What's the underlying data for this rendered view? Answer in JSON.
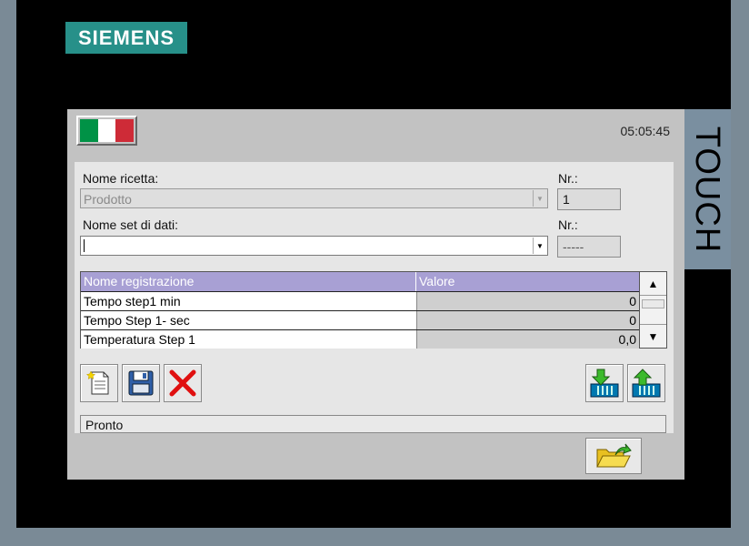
{
  "brand": {
    "logo_text": "SIEMENS",
    "side_label": "TOUCH"
  },
  "header": {
    "flag_colors": [
      "#009246",
      "#ffffff",
      "#ce2b37"
    ],
    "clock": "05:05:45"
  },
  "recipe": {
    "name_label": "Nome ricetta:",
    "name_value": "Prodotto",
    "nr_label": "Nr.:",
    "nr_value": "1"
  },
  "dataset": {
    "name_label": "Nome set di dati:",
    "name_value": "",
    "nr_label": "Nr.:",
    "nr_value": "-----"
  },
  "table": {
    "headers": [
      "Nome registrazione",
      "Valore"
    ],
    "rows": [
      {
        "name": "Tempo step1 min",
        "value": "0"
      },
      {
        "name": "Tempo Step 1- sec",
        "value": "0"
      },
      {
        "name": "Temperatura Step 1",
        "value": "0,0"
      }
    ]
  },
  "toolbar": {
    "buttons": [
      "new-record-icon",
      "save-icon",
      "delete-icon",
      "load-to-plc-icon",
      "read-from-plc-icon"
    ]
  },
  "status": {
    "text": "Pronto"
  },
  "colors": {
    "header_bg": "#a8a0d4",
    "logo_bg": "#279089",
    "screen_bg": "#c2c2c2",
    "panel_bg": "#e6e6e6"
  },
  "footer": {
    "open_button_icon": "open-folder-icon"
  }
}
